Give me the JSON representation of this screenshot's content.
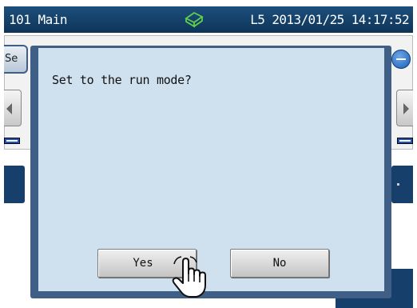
{
  "status_bar": {
    "screen_name": "101 Main",
    "mode_icon": "run-mode-icon",
    "datetime": "L5 2013/01/25 14:17:52"
  },
  "background": {
    "tab_label": "Se"
  },
  "dialog": {
    "message": "Set to the run mode?",
    "yes_label": "Yes",
    "no_label": "No"
  },
  "cursor": {
    "icon": "hand-pointer-icon"
  },
  "colors": {
    "status_bar": "#0d3458",
    "dialog_frame": "#3f5f86",
    "dialog_body": "#cfe1ef",
    "button": "#d8d8d8"
  }
}
